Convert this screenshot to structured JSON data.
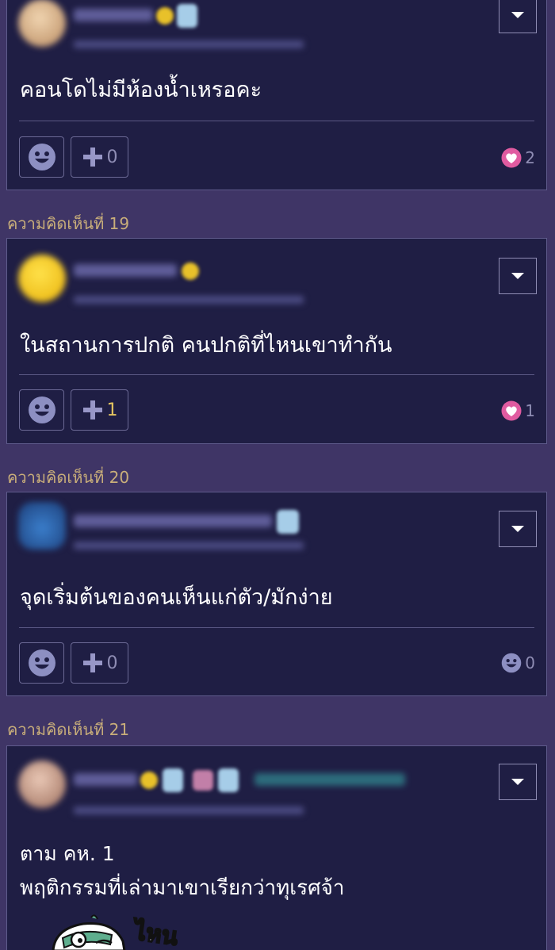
{
  "comments": [
    {
      "body": "คอนโดไม่มีห้องน้ำเหรอคะ",
      "plus_count": "0",
      "plus_active": false,
      "reaction_type": "heart",
      "reaction_count": "2"
    },
    {
      "label": "ความคิดเห็นที่ 19",
      "body": "ในสถานการปกติ คนปกติที่ไหนเขาทำกัน",
      "plus_count": "1",
      "plus_active": true,
      "reaction_type": "heart",
      "reaction_count": "1"
    },
    {
      "label": "ความคิดเห็นที่ 20",
      "body": "จุดเริ่มต้นของคนเห็นแก่ตัว/มักง่าย",
      "plus_count": "0",
      "plus_active": false,
      "reaction_type": "smile",
      "reaction_count": "0"
    },
    {
      "label": "ความคิดเห็นที่ 21",
      "body_line1": "ตาม คห. 1",
      "body_line2": "พฤติกรรมที่เล่ามาเขาเรียกว่าทุเรศจ้า",
      "sticker_text": "ไหน"
    }
  ],
  "colors": {
    "page_bg": "#3f3566",
    "card_bg": "#1f1e44",
    "label": "#c9ae7a",
    "heart": "#e0559a",
    "plus_active": "#e4c561"
  },
  "icons": [
    "chevron-down-icon",
    "smile-icon",
    "plus-icon",
    "heart-icon"
  ]
}
